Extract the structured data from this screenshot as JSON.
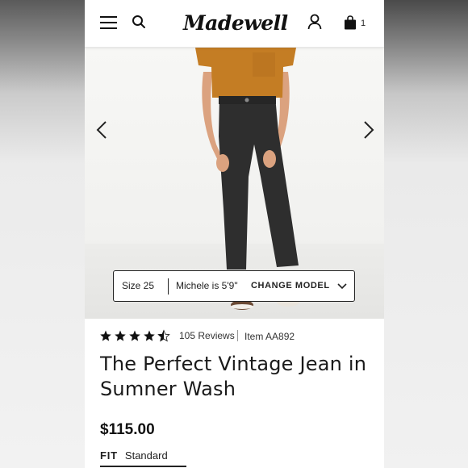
{
  "header": {
    "logo_text": "Madewell",
    "bag_count": "1",
    "icons": {
      "menu": "hamburger-menu-icon",
      "search": "search-icon",
      "account": "account-icon",
      "bag": "shopping-bag-icon"
    }
  },
  "gallery": {
    "prev_icon": "chevron-left-icon",
    "next_icon": "chevron-right-icon",
    "size_text": "Size 25",
    "model_text": "Michele is 5'9\"",
    "change_model_label": "CHANGE MODEL",
    "change_model_icon": "chevron-down-icon"
  },
  "product": {
    "rating": 4.5,
    "rating_max": 5,
    "review_count": "105 Reviews",
    "item_number": "Item AA892",
    "title": "The Perfect Vintage Jean in Sumner Wash",
    "price": "$115.00",
    "fit_label": "FIT",
    "fit_value": "Standard"
  },
  "colors": {
    "shirt": "#c47d24",
    "jeans": "#2e2e2e",
    "text": "#111111",
    "background": "#ffffff"
  }
}
